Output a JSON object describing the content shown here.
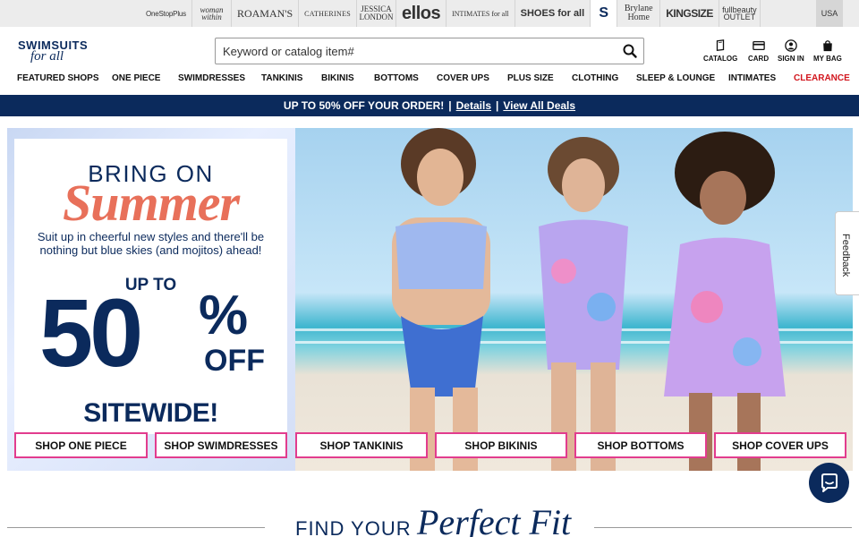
{
  "brands": [
    {
      "label": "OneStopPlus",
      "cls": "b-onestop"
    },
    {
      "label": "woman within",
      "cls": "b-woman"
    },
    {
      "label": "ROAMAN'S",
      "cls": "b-roamans"
    },
    {
      "label": "CATHERINES",
      "cls": "b-cath"
    },
    {
      "label": "JESSICA LONDON",
      "cls": "b-jessica"
    },
    {
      "label": "ellos",
      "cls": "b-ellos"
    },
    {
      "label": "INTIMATES for all",
      "cls": "b-intimates"
    },
    {
      "label": "SHOES for all",
      "cls": "b-shoes"
    },
    {
      "label": "S",
      "cls": "b-swim"
    },
    {
      "label": "Brylane Home",
      "cls": "b-brylane"
    },
    {
      "label": "KINGSIZE",
      "cls": "b-king"
    },
    {
      "label": "fullbeauty OUTLET",
      "cls": "b-outlet"
    }
  ],
  "country": "USA",
  "logo": {
    "top": "SWIMSUITS",
    "bottom": "for all"
  },
  "search": {
    "placeholder": "Keyword or catalog item#"
  },
  "header_icons": {
    "catalog": "CATALOG",
    "card": "CARD",
    "sign_in": "SIGN IN",
    "bag": "MY BAG"
  },
  "icons": [
    "search-icon",
    "catalog-icon",
    "card-icon",
    "user-icon",
    "bag-icon",
    "chat-icon"
  ],
  "nav": [
    "FEATURED SHOPS",
    "ONE PIECE",
    "SWIMDRESSES",
    "TANKINIS",
    "BIKINIS",
    "BOTTOMS",
    "COVER UPS",
    "PLUS SIZE",
    "CLOTHING",
    "SLEEP & LOUNGE",
    "INTIMATES",
    "CLEARANCE"
  ],
  "promo": {
    "text": "UP TO 50% OFF YOUR ORDER!",
    "sep1": "|",
    "details": "Details",
    "sep2": "|",
    "all_deals": "View All Deals"
  },
  "hero": {
    "bring": "BRING ON",
    "summer": "Summer",
    "sub": "Suit up in cheerful new styles and there'll be nothing but blue skies (and mojitos) ahead!",
    "upto": "UP TO",
    "big": "50",
    "pct": "%",
    "off": "OFF",
    "sitewide": "SITEWIDE!"
  },
  "shop_buttons": [
    "SHOP ONE PIECE",
    "SHOP SWIMDRESSES",
    "SHOP TANKINIS",
    "SHOP BIKINIS",
    "SHOP BOTTOMS",
    "SHOP COVER UPS"
  ],
  "feedback": "Feedback",
  "find": {
    "plain": "FIND YOUR",
    "script": "Perfect Fit"
  },
  "colors": {
    "navy": "#0b2a5c",
    "pink_border": "#e23c8e",
    "coral": "#e8705a",
    "clearance": "#d2161e"
  }
}
